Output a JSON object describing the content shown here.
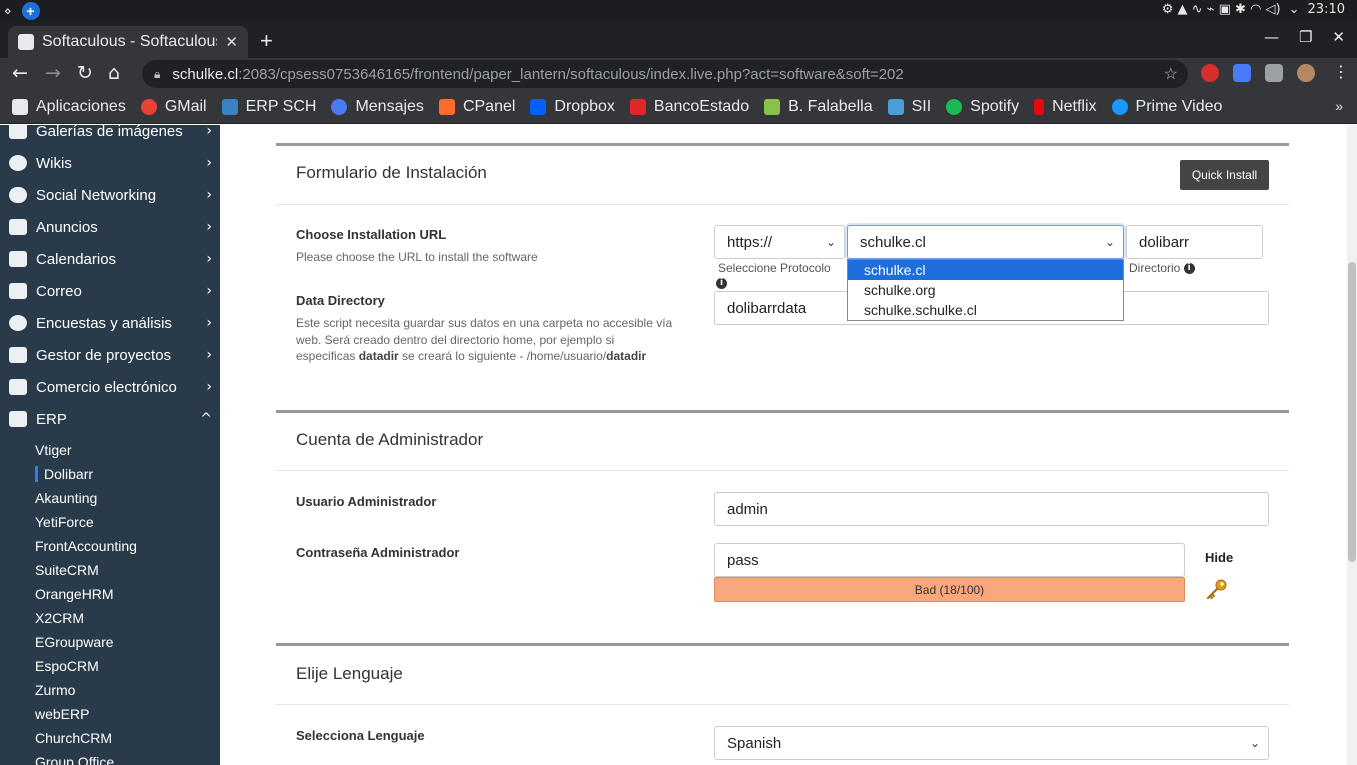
{
  "system": {
    "clock": "23:10"
  },
  "browser": {
    "tab_title": "Softaculous - Softaculous",
    "url_host": "schulke.cl",
    "url_rest": ":2083/cpsess0753646165/frontend/paper_lantern/softaculous/index.live.php?act=software&soft=202",
    "bookmarks": [
      {
        "label": "Aplicaciones",
        "icon": "apps-grid-icon",
        "color": "#e8eaed"
      },
      {
        "label": "GMail",
        "icon": "google-icon",
        "color": "#ea4335"
      },
      {
        "label": "ERP SCH",
        "icon": "erp-icon",
        "color": "#3b82c4"
      },
      {
        "label": "Mensajes",
        "icon": "messages-icon",
        "color": "#4a7bf7"
      },
      {
        "label": "CPanel",
        "icon": "cpanel-icon",
        "color": "#ff6c2c"
      },
      {
        "label": "Dropbox",
        "icon": "dropbox-icon",
        "color": "#0061fe"
      },
      {
        "label": "BancoEstado",
        "icon": "bancoestado-icon",
        "color": "#e5252a"
      },
      {
        "label": "B. Falabella",
        "icon": "falabella-icon",
        "color": "#8bc34a"
      },
      {
        "label": "SII",
        "icon": "sii-icon",
        "color": "#4a9fd8"
      },
      {
        "label": "Spotify",
        "icon": "spotify-icon",
        "color": "#1db954"
      },
      {
        "label": "Netflix",
        "icon": "netflix-icon",
        "color": "#e50914"
      },
      {
        "label": "Prime Video",
        "icon": "prime-video-icon",
        "color": "#1a98ff"
      }
    ]
  },
  "sidebar": {
    "categories": [
      {
        "label": "Galerías de imágenes",
        "icon": "image-gallery-icon",
        "chevron": "›"
      },
      {
        "label": "Wikis",
        "icon": "globe-icon",
        "chevron": "›"
      },
      {
        "label": "Social Networking",
        "icon": "chat-icon",
        "chevron": "›"
      },
      {
        "label": "Anuncios",
        "icon": "megaphone-icon",
        "chevron": "›"
      },
      {
        "label": "Calendarios",
        "icon": "calendar-icon",
        "chevron": "›"
      },
      {
        "label": "Correo",
        "icon": "mail-icon",
        "chevron": "›"
      },
      {
        "label": "Encuestas y análisis",
        "icon": "pie-chart-icon",
        "chevron": "›"
      },
      {
        "label": "Gestor de proyectos",
        "icon": "edit-icon",
        "chevron": "›"
      },
      {
        "label": "Comercio electrónico",
        "icon": "cart-icon",
        "chevron": "›"
      },
      {
        "label": "ERP",
        "icon": "bar-chart-icon",
        "chevron": "^"
      }
    ],
    "erp_items": [
      "Vtiger",
      "Dolibarr",
      "Akaunting",
      "YetiForce",
      "FrontAccounting",
      "SuiteCRM",
      "OrangeHRM",
      "X2CRM",
      "EGroupware",
      "EspoCRM",
      "Zurmo",
      "webERP",
      "ChurchCRM",
      "Group Office"
    ]
  },
  "install_form": {
    "title": "Formulario de Instalación",
    "quick_install": "Quick Install",
    "url_label": "Choose Installation URL",
    "url_help": "Please choose the URL to install the software",
    "protocol_value": "https://",
    "protocol_caption": "Seleccione Protocolo",
    "domain_value": "schulke.cl",
    "domain_options": [
      "schulke.cl",
      "schulke.org",
      "schulke.schulke.cl"
    ],
    "directory_value": "dolibarr",
    "directory_caption": "Directorio",
    "datadir_label": "Data Directory",
    "datadir_help_1": "Este script necesita guardar sus datos en una carpeta no accesible vía web. Será creado dentro del directorio home, por ejemplo si especificas ",
    "datadir_help_bold1": "datadir",
    "datadir_help_2": " se creará lo siguiente - /home/usuario/",
    "datadir_help_bold2": "datadir",
    "datadir_value": "dolibarrdata"
  },
  "admin": {
    "title": "Cuenta de Administrador",
    "user_label": "Usuario Administrador",
    "user_value": "admin",
    "pass_label": "Contraseña Administrador",
    "pass_value": "pass",
    "hide_label": "Hide",
    "strength": "Bad (18/100)"
  },
  "language": {
    "title": "Elije Lenguaje",
    "label": "Selecciona Lenguaje",
    "value": "Spanish"
  }
}
